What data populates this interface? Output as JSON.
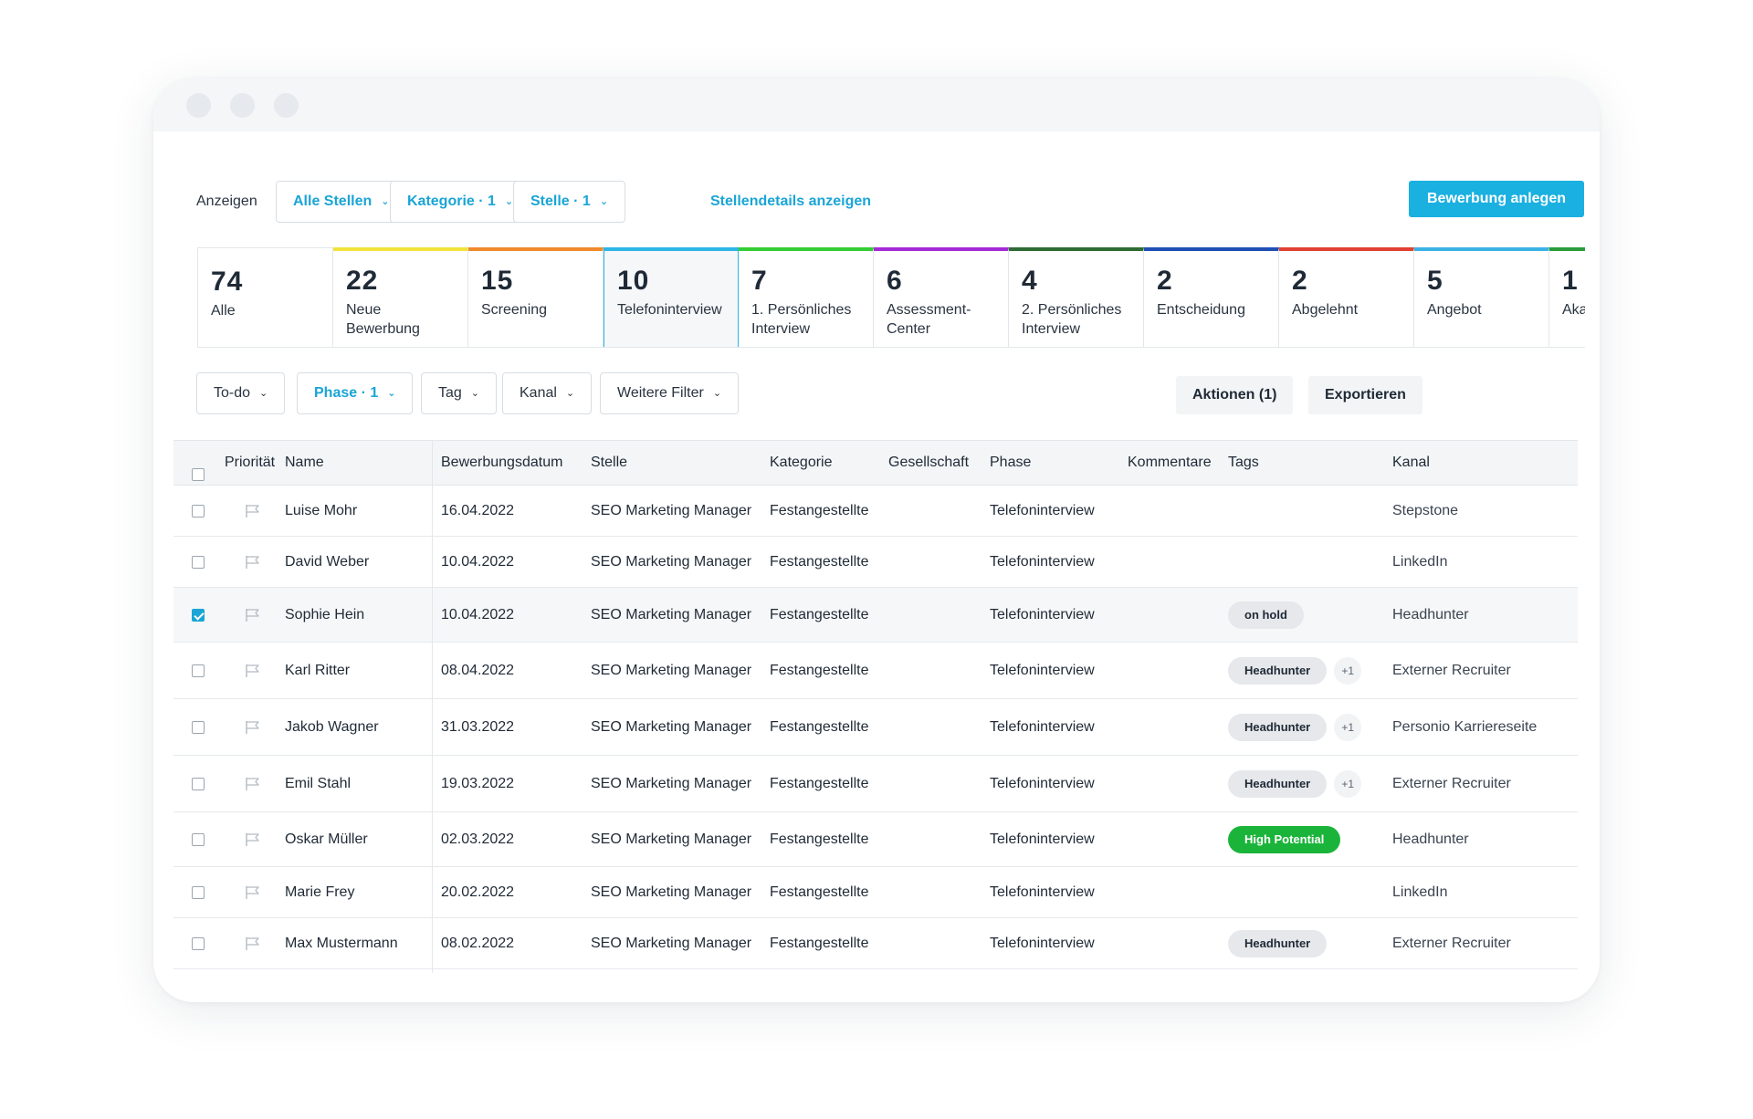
{
  "toolbar": {
    "show_label": "Anzeigen",
    "filters": [
      {
        "label": "Alle Stellen"
      },
      {
        "label": "Kategorie · 1"
      },
      {
        "label": "Stelle · 1"
      }
    ],
    "details_link": "Stellendetails anzeigen",
    "create_button": "Bewerbung anlegen"
  },
  "stages": [
    {
      "count": "74",
      "label": "Alle",
      "color": ""
    },
    {
      "count": "22",
      "label": "Neue Bewerbung",
      "color": "#f2e33a"
    },
    {
      "count": "15",
      "label": "Screening",
      "color": "#f08a2c"
    },
    {
      "count": "10",
      "label": "Telefoninterview",
      "color": "#2cb5e5",
      "active": true
    },
    {
      "count": "7",
      "label": "1. Persönliches Interview",
      "color": "#33cc33"
    },
    {
      "count": "6",
      "label": "Assessment-Center",
      "color": "#a32ad6"
    },
    {
      "count": "4",
      "label": "2. Persönliches Interview",
      "color": "#2e6b34"
    },
    {
      "count": "2",
      "label": "Entscheidung",
      "color": "#1f4fb5"
    },
    {
      "count": "2",
      "label": "Abgelehnt",
      "color": "#e04134"
    },
    {
      "count": "5",
      "label": "Angebot",
      "color": "#3ab2e6"
    },
    {
      "count": "1",
      "label": "Aka",
      "color": "#2a9d3a"
    }
  ],
  "filterbar": {
    "filters": [
      {
        "label": "To-do"
      },
      {
        "label": "Phase · 1"
      },
      {
        "label": "Tag"
      },
      {
        "label": "Kanal"
      },
      {
        "label": "Weitere Filter"
      }
    ],
    "actions_button": "Aktionen (1)",
    "export_button": "Exportieren"
  },
  "table": {
    "headers": {
      "priority": "Priorität",
      "name": "Name",
      "date": "Bewerbungsdatum",
      "position": "Stelle",
      "category": "Kategorie",
      "company": "Gesellschaft",
      "phase": "Phase",
      "comments": "Kommentare",
      "tags": "Tags",
      "channel": "Kanal"
    },
    "rows": [
      {
        "name": "Luise Mohr",
        "date": "16.04.2022",
        "position": "SEO Marketing Manager",
        "category": "Festangestellte",
        "phase": "Telefoninterview",
        "tag": "",
        "tag_style": "",
        "more": "",
        "channel": "Stepstone",
        "checked": false
      },
      {
        "name": "David Weber",
        "date": "10.04.2022",
        "position": "SEO Marketing Manager",
        "category": "Festangestellte",
        "phase": "Telefoninterview",
        "tag": "",
        "tag_style": "",
        "more": "",
        "channel": "LinkedIn",
        "checked": false
      },
      {
        "name": "Sophie Hein",
        "date": "10.04.2022",
        "position": "SEO Marketing Manager",
        "category": "Festangestellte",
        "phase": "Telefoninterview",
        "tag": "on hold",
        "tag_style": "gray",
        "more": "",
        "channel": "Headhunter",
        "checked": true
      },
      {
        "name": "Karl Ritter",
        "date": "08.04.2022",
        "position": "SEO Marketing Manager",
        "category": "Festangestellte",
        "phase": "Telefoninterview",
        "tag": "Headhunter",
        "tag_style": "gray",
        "more": "+1",
        "channel": "Externer Recruiter",
        "checked": false
      },
      {
        "name": "Jakob Wagner",
        "date": "31.03.2022",
        "position": "SEO Marketing Manager",
        "category": "Festangestellte",
        "phase": "Telefoninterview",
        "tag": "Headhunter",
        "tag_style": "gray",
        "more": "+1",
        "channel": "Personio Karriereseite",
        "checked": false
      },
      {
        "name": "Emil Stahl",
        "date": "19.03.2022",
        "position": "SEO Marketing Manager",
        "category": "Festangestellte",
        "phase": "Telefoninterview",
        "tag": "Headhunter",
        "tag_style": "gray",
        "more": "+1",
        "channel": "Externer Recruiter",
        "checked": false
      },
      {
        "name": "Oskar Müller",
        "date": "02.03.2022",
        "position": "SEO Marketing Manager",
        "category": "Festangestellte",
        "phase": "Telefoninterview",
        "tag": "High Potential",
        "tag_style": "green",
        "more": "",
        "channel": "Headhunter",
        "checked": false
      },
      {
        "name": "Marie Frey",
        "date": "20.02.2022",
        "position": "SEO Marketing Manager",
        "category": "Festangestellte",
        "phase": "Telefoninterview",
        "tag": "",
        "tag_style": "",
        "more": "",
        "channel": "LinkedIn",
        "checked": false
      },
      {
        "name": "Max Mustermann",
        "date": "08.02.2022",
        "position": "SEO Marketing Manager",
        "category": "Festangestellte",
        "phase": "Telefoninterview",
        "tag": "Headhunter",
        "tag_style": "gray",
        "more": "",
        "channel": "Externer Recruiter",
        "checked": false
      }
    ]
  },
  "colors": {
    "accent": "#1aa5d6",
    "primary_button": "#1ab0e0",
    "tag_gray": "#e6e8eb",
    "tag_green": "#1bb43a"
  }
}
